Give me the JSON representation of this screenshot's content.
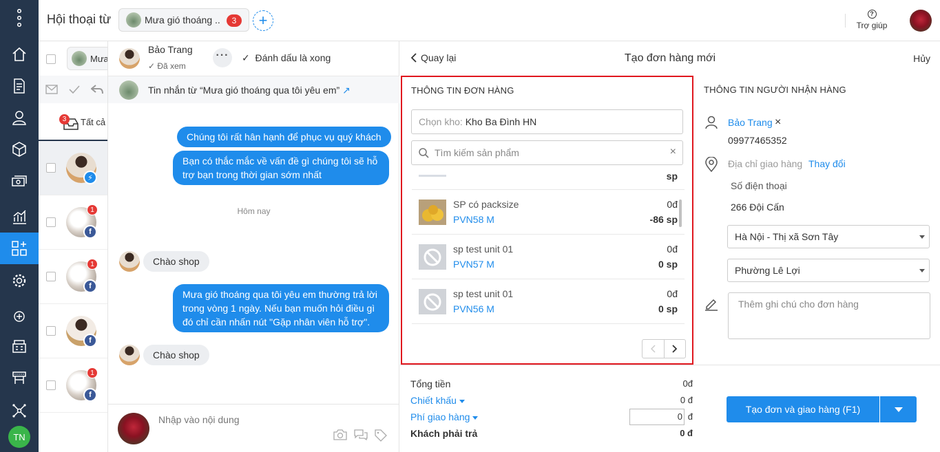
{
  "header": {
    "title": "Hội thoại từ",
    "tab_label": "Mưa gió thoáng ..",
    "tab_badge": "3",
    "help_label": "Trợ giúp"
  },
  "nav": {
    "user_initials": "TN",
    "icons": [
      "menu-dots-icon",
      "home-icon",
      "document-icon",
      "user-icon",
      "box-icon",
      "money-icon",
      "chart-icon",
      "apps-icon",
      "settings-icon",
      "add-circle-icon",
      "store-icon",
      "pos-icon",
      "network-icon"
    ]
  },
  "convlist": {
    "chip_label": "Mưa",
    "tab_all_label": "Tất cả",
    "tab_all_badge": "3",
    "items": [
      {
        "badge": "",
        "source": "messenger"
      },
      {
        "badge": "1",
        "source": "facebook"
      },
      {
        "badge": "1",
        "source": "facebook"
      },
      {
        "badge": "",
        "source": "facebook"
      },
      {
        "badge": "1",
        "source": "facebook"
      }
    ]
  },
  "chat": {
    "contact_name": "Bảo Trang",
    "seen_label": "Đã xem",
    "mark_done_label": "Đánh dấu là xong",
    "from_label": "Tin nhắn từ  “Mưa gió thoáng qua tôi yêu em”",
    "messages": {
      "m1": "Chúng tôi rất hân hạnh để phục vụ quý khách",
      "m2": "Bạn có thắc mắc về vấn đề gì chúng tôi sẽ hỗ trợ bạn trong thời gian sớm nhất",
      "today": "Hôm nay",
      "m3": "Chào shop",
      "m4": "Mưa gió thoáng qua tôi yêu em thường trả lời trong vòng 1 ngày. Nếu bạn muốn hỏi điều gì đó chỉ cần nhấn nút \"Gặp nhân viên hỗ trợ\".",
      "m5": "Chào shop"
    },
    "composer_placeholder": "Nhập vào nội dung"
  },
  "order": {
    "back_label": "Quay lại",
    "title": "Tạo đơn hàng mới",
    "cancel_label": "Hủy",
    "info_title": "THÔNG TIN ĐƠN HÀNG",
    "warehouse_label": "Chọn kho:",
    "warehouse_value": "Kho Ba Đình HN",
    "search_placeholder": "Tìm kiếm sản phẩm",
    "partial_unit": "sp",
    "products": [
      {
        "name": "SP có packsize",
        "code": "PVN58 M",
        "price": "0đ",
        "qty": "-86 sp",
        "image": "product-photo"
      },
      {
        "name": "sp test unit 01",
        "code": "PVN57 M",
        "price": "0đ",
        "qty": "0 sp",
        "image": "no-image-icon"
      },
      {
        "name": "sp test unit 01",
        "code": "PVN56 M",
        "price": "0đ",
        "qty": "0 sp",
        "image": "no-image-icon"
      }
    ],
    "receiver_title": "THÔNG TIN NGƯỜI NHẬN HÀNG",
    "receiver_name": "Bảo Trang",
    "receiver_phone": "09977465352",
    "address_label": "Địa chỉ giao hàng",
    "change_label": "Thay đổi",
    "phone_field": "Số điện thoại",
    "address_value": "266 Đội Cấn",
    "district_value": "Hà Nội - Thị xã Sơn Tây",
    "ward_value": "Phường Lê Lợi",
    "note_placeholder": "Thêm ghi chú cho đơn hàng",
    "totals": {
      "total_label": "Tổng tiền",
      "total_value": "0đ",
      "discount_label": "Chiết khấu",
      "discount_value": "0 đ",
      "shipping_label": "Phí giao hàng",
      "shipping_input": "0",
      "shipping_unit": "đ",
      "pay_label": "Khách phải trả",
      "pay_value": "0 đ"
    },
    "submit_label": "Tạo đơn và giao hàng (F1)"
  },
  "colors": {
    "nav_bg": "#25364c",
    "accent": "#1f8ceb",
    "highlight_border": "#e0161e",
    "badge": "#e53935"
  }
}
